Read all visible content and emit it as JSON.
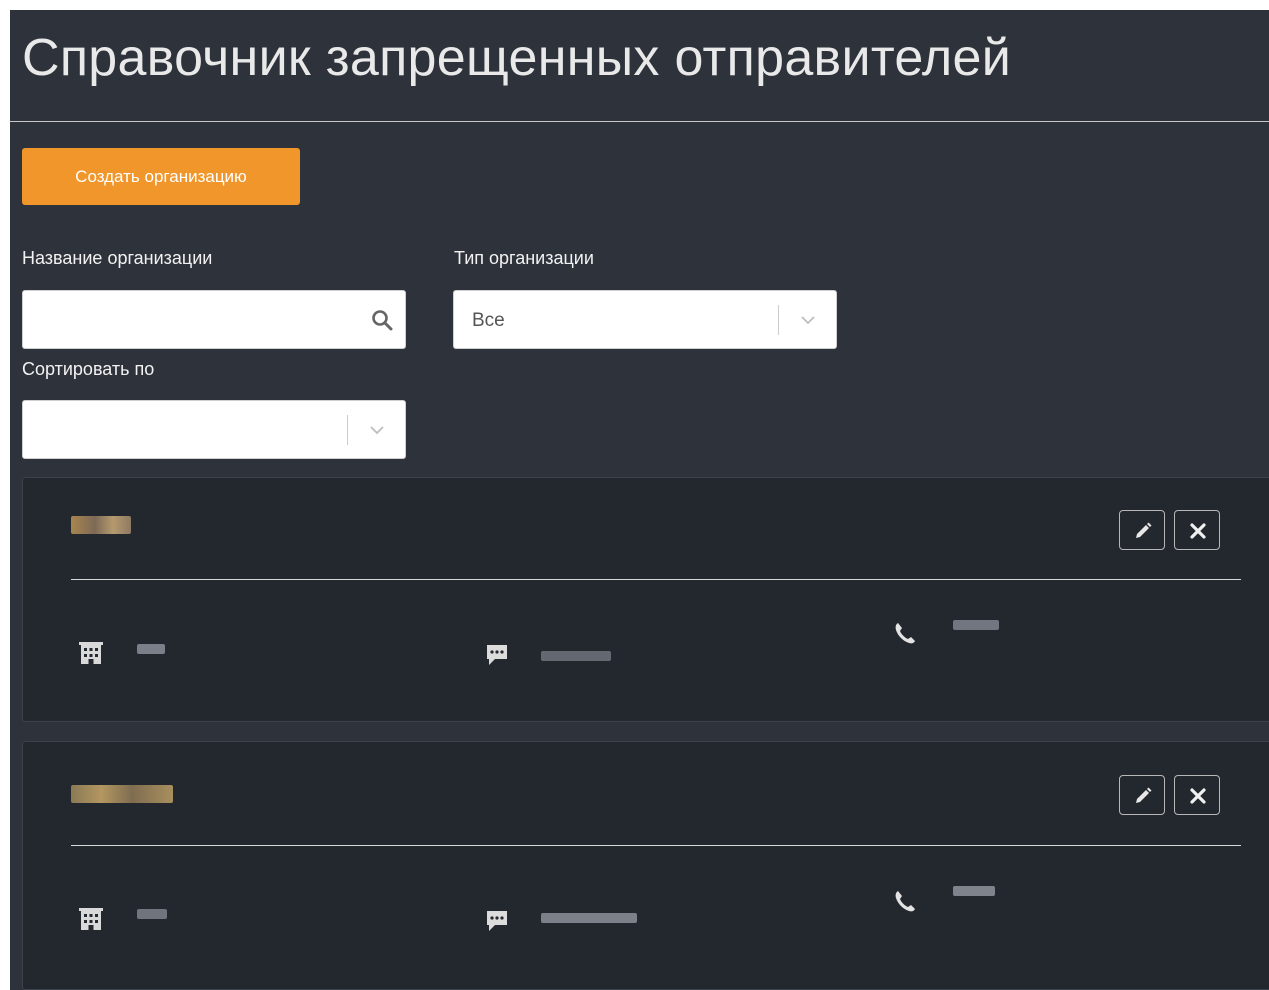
{
  "page": {
    "title": "Справочник запрещенных отправителей"
  },
  "toolbar": {
    "create_label": "Создать организацию"
  },
  "filters": {
    "org_name_label": "Название организации",
    "org_name_value": "",
    "org_type_label": "Тип организации",
    "org_type_value": "Все",
    "sort_label": "Сортировать по",
    "sort_value": ""
  },
  "icons": {
    "search": "search-icon",
    "dropdown": "chevron-down-icon",
    "edit": "pencil-icon",
    "delete": "close-icon",
    "building": "building-icon",
    "message": "comment-icon",
    "phone": "phone-icon"
  },
  "colors": {
    "background": "#2e333b",
    "card": "#23272e",
    "accent": "#f0962a",
    "text": "#e9e9e9"
  }
}
